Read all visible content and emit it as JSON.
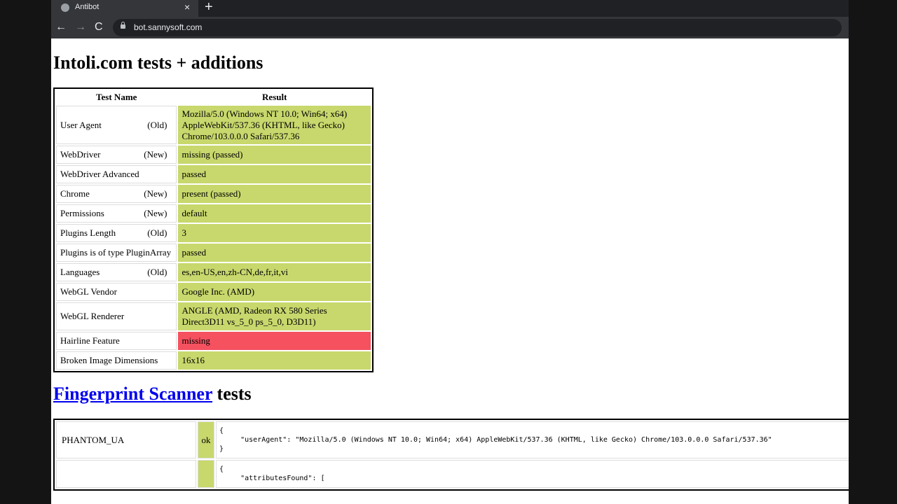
{
  "browser": {
    "tab_title": "Antibot",
    "tab_close": "×",
    "new_tab": "+",
    "back": "←",
    "forward": "→",
    "reload": "C",
    "url": "bot.sannysoft.com"
  },
  "intoli": {
    "heading": "Intoli.com tests + additions",
    "headers": [
      "Test Name",
      "Result"
    ],
    "rows": [
      {
        "name": "User Agent",
        "flag": "(Old)",
        "result": "Mozilla/5.0 (Windows NT 10.0; Win64; x64) AppleWebKit/537.36 (KHTML, like Gecko) Chrome/103.0.0.0 Safari/537.36",
        "status": "passed"
      },
      {
        "name": "WebDriver",
        "flag": "(New)",
        "result": "missing (passed)",
        "status": "passed"
      },
      {
        "name": "WebDriver Advanced",
        "flag": "",
        "result": "passed",
        "status": "passed"
      },
      {
        "name": "Chrome",
        "flag": "(New)",
        "result": "present (passed)",
        "status": "passed"
      },
      {
        "name": "Permissions",
        "flag": "(New)",
        "result": "default",
        "status": "passed"
      },
      {
        "name": "Plugins Length",
        "flag": "(Old)",
        "result": "3",
        "status": "passed"
      },
      {
        "name": "Plugins is of type PluginArray",
        "flag": "",
        "result": "passed",
        "status": "passed"
      },
      {
        "name": "Languages",
        "flag": "(Old)",
        "result": "es,en-US,en,zh-CN,de,fr,it,vi",
        "status": "passed"
      },
      {
        "name": "WebGL Vendor",
        "flag": "",
        "result": "Google Inc. (AMD)",
        "status": "passed"
      },
      {
        "name": "WebGL Renderer",
        "flag": "",
        "result": "ANGLE (AMD, Radeon RX 580 Series Direct3D11 vs_5_0 ps_5_0, D3D11)",
        "status": "passed"
      },
      {
        "name": "Hairline Feature",
        "flag": "",
        "result": "missing",
        "status": "failed"
      },
      {
        "name": "Broken Image Dimensions",
        "flag": "",
        "result": "16x16",
        "status": "passed"
      }
    ]
  },
  "fingerprint": {
    "heading_link": "Fingerprint Scanner",
    "heading_rest": " tests",
    "rows": [
      {
        "name": "PHANTOM_UA",
        "status": "ok",
        "code": "{\n     \"userAgent\": \"Mozilla/5.0 (Windows NT 10.0; Win64; x64) AppleWebKit/537.36 (KHTML, like Gecko) Chrome/103.0.0.0 Safari/537.36\"\n}"
      },
      {
        "name": "",
        "status": "",
        "code": "{\n     \"attributesFound\": ["
      }
    ]
  },
  "colors": {
    "passed": "#c8d86d",
    "failed": "#f5515f",
    "link": "#0000ee"
  }
}
